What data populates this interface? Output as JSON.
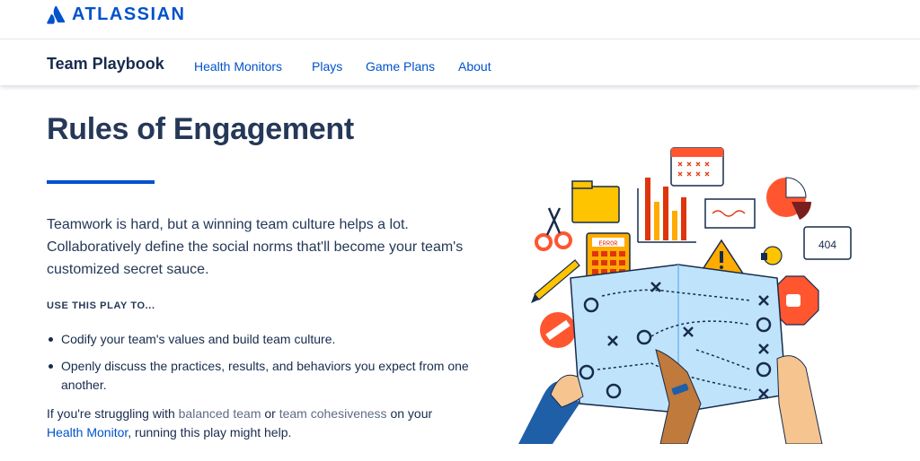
{
  "brand": {
    "name": "ATLASSIAN",
    "color": "#0052cc"
  },
  "nav": {
    "title": "Team Playbook",
    "links": [
      "Health Monitors",
      "Plays",
      "Game Plans",
      "About"
    ]
  },
  "hero": {
    "title": "Rules of Engagement",
    "intro": "Teamwork is hard, but a winning team culture helps a lot. Collaboratively define the social norms that'll become your team's customized secret sauce.",
    "subheading": "USE THIS PLAY TO...",
    "bullets": [
      "Codify your team's values and build team culture.",
      "Openly discuss the practices, results, and behaviors you expect from one another."
    ],
    "help": {
      "prefix": "If you're struggling with ",
      "link1": "balanced team",
      "mid1": " or ",
      "link2": "team cohesiveness",
      "mid2": " on your ",
      "link3": "Health Monitor",
      "suffix": ", running this play might help."
    }
  },
  "illustration": {
    "error_label": "ERROR",
    "code_label": "404"
  }
}
